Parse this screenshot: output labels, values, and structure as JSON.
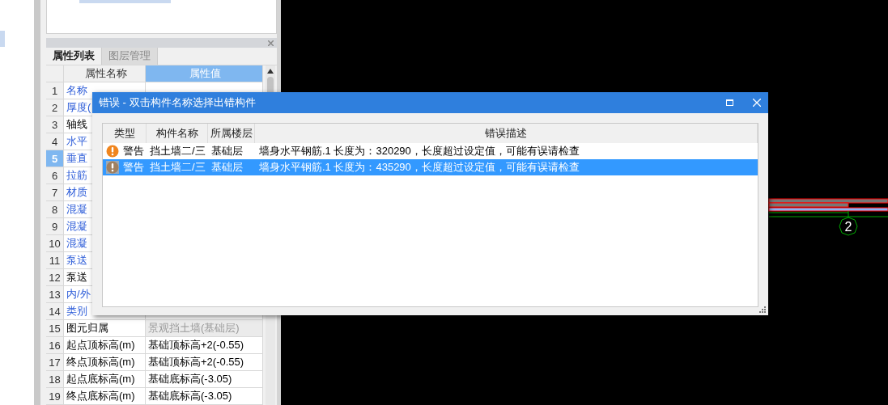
{
  "property_panel": {
    "tabs": [
      {
        "label": "属性列表",
        "selected": true
      },
      {
        "label": "图层管理",
        "selected": false
      }
    ],
    "columns": [
      "属性名称",
      "属性值"
    ],
    "rows": [
      {
        "index": "1",
        "name": "名称",
        "public": true,
        "selected": false
      },
      {
        "index": "2",
        "name": "厚度(",
        "public": true,
        "selected": false
      },
      {
        "index": "3",
        "name": "轴线",
        "public": false,
        "selected": false
      },
      {
        "index": "4",
        "name": "水平",
        "public": true,
        "selected": false
      },
      {
        "index": "5",
        "name": "垂直",
        "public": true,
        "selected": true
      },
      {
        "index": "6",
        "name": "拉筋",
        "public": true,
        "selected": false
      },
      {
        "index": "7",
        "name": "材质",
        "public": true,
        "selected": false
      },
      {
        "index": "8",
        "name": "混凝",
        "public": true,
        "selected": false
      },
      {
        "index": "9",
        "name": "混凝",
        "public": true,
        "selected": false
      },
      {
        "index": "10",
        "name": "混凝",
        "public": true,
        "selected": false
      },
      {
        "index": "11",
        "name": "泵送",
        "public": true,
        "selected": false
      },
      {
        "index": "12",
        "name": "泵送",
        "public": false,
        "selected": false
      },
      {
        "index": "13",
        "name": "内/外",
        "public": true,
        "selected": false
      },
      {
        "index": "14",
        "name": "类别",
        "public": true,
        "selected": false
      },
      {
        "index": "15",
        "name": "图元归属",
        "value": "景观挡土墙(基础层)",
        "public": false,
        "selected": false,
        "disabled": true
      },
      {
        "index": "16",
        "name": "起点顶标高(m)",
        "value": "基础顶标高+2(-0.55)",
        "public": false,
        "selected": false,
        "disabled": false
      },
      {
        "index": "17",
        "name": "终点顶标高(m)",
        "value": "基础顶标高+2(-0.55)",
        "public": false,
        "selected": false,
        "disabled": false
      },
      {
        "index": "18",
        "name": "起点底标高(m)",
        "value": "基础底标高(-3.05)",
        "public": false,
        "selected": false,
        "disabled": false
      },
      {
        "index": "19",
        "name": "终点底标高(m)",
        "value": "基础底标高(-3.05)",
        "public": false,
        "selected": false,
        "disabled": false
      }
    ]
  },
  "dialog": {
    "title": "错误 - 双击构件名称选择出错构件",
    "columns": [
      "类型",
      "构件名称",
      "所属楼层",
      "错误描述"
    ],
    "rows": [
      {
        "kind": "warning",
        "type": "警告",
        "component": "挡土墙二/三",
        "floor": "基础层",
        "description": "墙身水平钢筋.1 长度为：320290，长度超过设定值，可能有误请检查",
        "selected": false
      },
      {
        "kind": "warning",
        "type": "警告",
        "component": "挡土墙二/三",
        "floor": "基础层",
        "description": "墙身水平钢筋.1 长度为：435290，长度超过设定值，可能有误请检查",
        "selected": true
      }
    ]
  },
  "canvas": {
    "axis_label": "2"
  }
}
